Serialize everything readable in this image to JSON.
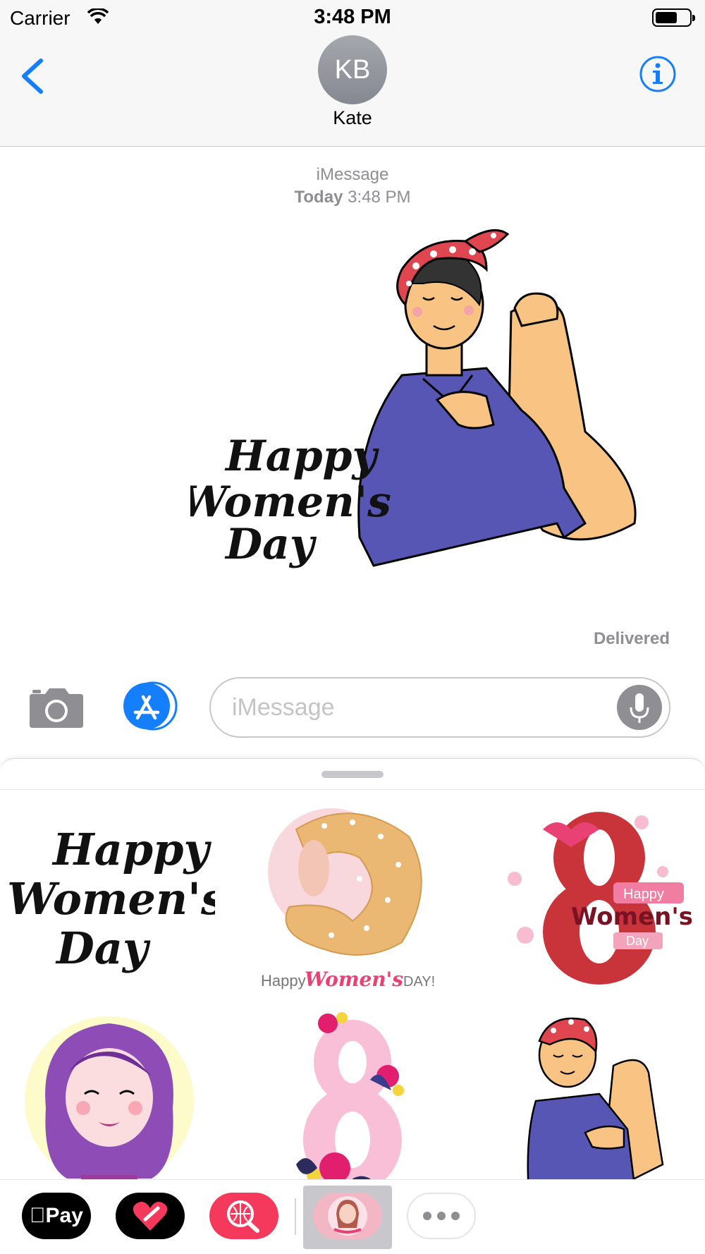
{
  "status_bar": {
    "carrier": "Carrier",
    "time": "3:48 PM"
  },
  "header": {
    "avatar_initials": "KB",
    "contact_name": "Kate"
  },
  "conversation": {
    "service": "iMessage",
    "day": "Today",
    "time": "3:48 PM",
    "status": "Delivered",
    "sticker_text": [
      "Happy",
      "Women's",
      "Day"
    ]
  },
  "compose": {
    "placeholder": "iMessage"
  },
  "stickers": [
    {
      "lines": [
        "Happy",
        "Women's",
        "Day"
      ]
    },
    {
      "lines": [
        "Happy",
        "Women's",
        "DAY!"
      ]
    },
    {
      "lines": [
        "Happy",
        "Women's",
        "Day"
      ]
    },
    {
      "lines": []
    },
    {
      "lines": []
    },
    {
      "lines": []
    }
  ],
  "app_strip": {
    "apple_pay_label": "Pay"
  },
  "colors": {
    "ios_blue": "#157efb",
    "shirt": "#5756b5",
    "bandana": "#e0464f",
    "skin": "#f9c483",
    "pink_accent": "#e94174"
  }
}
